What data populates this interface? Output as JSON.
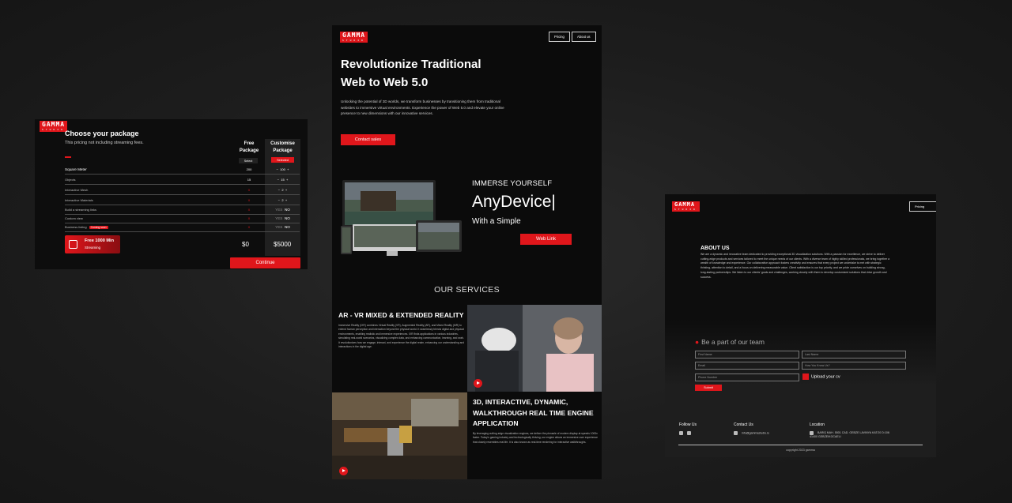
{
  "brand": {
    "logo": "GAMMA",
    "logo_sub": "STUDIO"
  },
  "pricing": {
    "title": "Choose your package",
    "subtitle": "This pricing not including streaming fees.",
    "col_free": {
      "title_l1": "Free",
      "title_l2": "Package",
      "button": "Select"
    },
    "col_custom": {
      "title_l1": "Customise",
      "title_l2": "Package",
      "button": "Selected"
    },
    "rows": [
      {
        "label": "Square Meter",
        "free": "200",
        "custom": "100"
      },
      {
        "label": "Objects",
        "free": "15",
        "custom": "15"
      },
      {
        "label": "Interactive Mesh",
        "free": "X",
        "custom": "2"
      },
      {
        "label": "Interactive Materials",
        "free": "X",
        "custom": "2"
      },
      {
        "label": "Build a streaming links",
        "free": "X",
        "custom_yes": "YES",
        "custom_no": "NO"
      },
      {
        "label": "Custom view",
        "free": "X",
        "custom_yes": "YES",
        "custom_no": "NO"
      },
      {
        "label": "Business listing",
        "badge": "Coming soon",
        "free": "X",
        "custom_yes": "YES",
        "custom_no": "NO"
      }
    ],
    "stepper_minus": "−",
    "stepper_plus": "+",
    "stream_title": "Free 1000 Min",
    "stream_sub": "Streaming",
    "price_free": "$0",
    "price_custom": "$5000",
    "continue": "Continue"
  },
  "landing": {
    "nav": {
      "pricing": "Pricing",
      "about": "About us"
    },
    "hero_l1": "Revolutionize Traditional",
    "hero_l2": "Web to Web 5.0",
    "hero_desc": "Unlocking the potential of 3D worlds, we transform businesses by transitioning them from traditional websites to immersive virtual environments. Experience the power of Web 5.0 and elevate your online presence to new dimensions with our innovative services.",
    "contact": "Contact sales",
    "immerse": "IMMERSE YOURSELF",
    "anydevice": "AnyDevice|",
    "simple": "With a Simple",
    "weblink": "Web Link",
    "services": "OUR SERVICES",
    "svc1_title": "AR - VR MIXED & EXTENDED REALITY",
    "svc1_text": "Immersive Reality (IXR) combines Virtual Reality (VR), Augmented Reality (AR), and Mixed Reality (MR) to extend human perception and interaction beyond the physical world. It seamlessly blends digital and physical environments, enabling realistic and immersive experiences. IXR finds applications in various industries, simulating real-world scenarios, visualizing complex data, and enhancing communication, learning, and work. It revolutionizes how we engage, interact, and experience the digital realm, enhancing our understanding and interactions in the digital age.",
    "svc2_title": "3D, INTERACTIVE, DYNAMIC, WALKTHROUGH REAL TIME ENGINE APPLICATION",
    "svc2_text": "By leveraging cutting-edge visualization engines, we deliver the pinnacle of modern display at speeds 1000x faster. Today's gaming industry and technologically thriving; our engine allows an immersive user experience that closely resembles real life. It is also known as real-time rendering for interactive walkthroughs."
  },
  "about": {
    "nav_pricing": "Pricing",
    "title": "ABOUT US",
    "text": "We are a dynamic and innovative team dedicated to providing exceptional 3D visualization solutions. With a passion for excellence, we strive to deliver cutting-edge products and services tailored to meet the unique needs of our clients. With a diverse team of highly skilled professionals, we bring together a wealth of knowledge and experience. Our collaborative approach fosters creativity and ensures that every project we undertake is met with strategic thinking, attention to detail, and a focus on delivering measurable value. Client satisfaction is our top priority, and we pride ourselves on building strong, long-lasting partnerships. We listen to our clients' goals and challenges, working closely with them to develop customized solutions that drive growth and success.",
    "join": "Be a part of our team",
    "first_name": "First Name",
    "last_name": "Last Name",
    "email": "Email",
    "how": "How You Know Us?",
    "phone": "Phone Number",
    "upload": "Upload your cv",
    "submit": "Submit",
    "follow": "Follow Us",
    "contact": "Contact Us",
    "contact_email": "info@gammastudio.io",
    "location": "Location",
    "location_addr": "BARIŞ MAH. 5501 CAD. GEBZE LAVINYA KAT:20 D:106 41400 GEBZE/KOCAELI",
    "copyright": "copyright 2023 gamma",
    "social": [
      "linkedin-icon",
      "youtube-icon"
    ]
  },
  "colors": {
    "accent": "#e0161b",
    "panel": "#0d0d0d",
    "background": "#1d1d1d"
  }
}
